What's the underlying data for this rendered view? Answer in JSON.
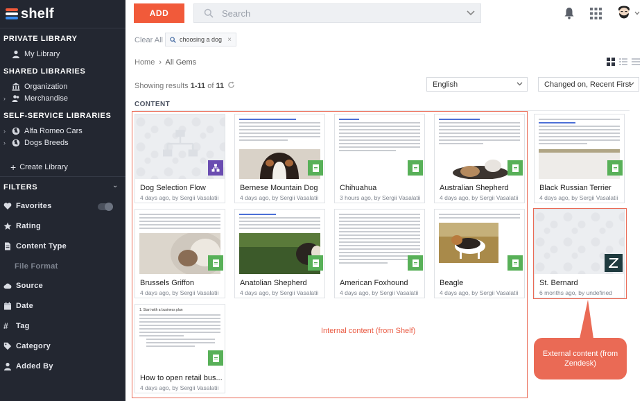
{
  "brand": {
    "name": "shelf"
  },
  "sidebar": {
    "private_library": "PRIVATE LIBRARY",
    "my_library": "My Library",
    "shared_libraries": "SHARED LIBRARIES",
    "organization": "Organization",
    "merchandise": "Merchandise",
    "self_service": "SELF-SERVICE LIBRARIES",
    "alfa_romeo": "Alfa Romeo Cars",
    "dogs_breeds": "Dogs Breeds",
    "create_library": "Create Library",
    "filters": "FILTERS",
    "filter_items": [
      "Favorites",
      "Rating",
      "Content Type",
      "File Format",
      "Source",
      "Date",
      "Tag",
      "Category",
      "Added By"
    ]
  },
  "toolbar": {
    "add_label": "ADD",
    "search_placeholder": "Search"
  },
  "filters_bar": {
    "clear_all": "Clear All",
    "chip_label": "choosing a dog"
  },
  "breadcrumb": {
    "home": "Home",
    "sep": "›",
    "current": "All Gems"
  },
  "results": {
    "prefix": "Showing results",
    "range": "1-11",
    "of": "of",
    "total": "11"
  },
  "language_select": "English",
  "sort_select": "Changed on, Recent First",
  "section_title": "CONTENT",
  "cards": [
    {
      "title": "Dog Selection Flow",
      "meta": "4 days ago, by Sergii Vasalatii"
    },
    {
      "title": "Bernese Mountain Dog",
      "meta": "4 days ago, by Sergii Vasalatii"
    },
    {
      "title": "Chihuahua",
      "meta": "3 hours ago, by Sergii Vasalatii"
    },
    {
      "title": "Australian Shepherd",
      "meta": "4 days ago, by Sergii Vasalatii"
    },
    {
      "title": "Black Russian Terrier",
      "meta": "4 days ago, by Sergii Vasalatii"
    },
    {
      "title": "Brussels Griffon",
      "meta": "4 days ago, by Sergii Vasalatii"
    },
    {
      "title": "Anatolian Shepherd",
      "meta": "4 days ago, by Sergii Vasalatii"
    },
    {
      "title": "American Foxhound",
      "meta": "4 days ago, by Sergii Vasalatii"
    },
    {
      "title": "Beagle",
      "meta": "4 days ago, by Sergii Vasalatii"
    },
    {
      "title": "St. Bernard",
      "meta": "6 months ago, by undefined"
    },
    {
      "title": "How to open retail bus...",
      "meta": "4 days ago, by Sergii Vasalatii"
    }
  ],
  "card_snippets": {
    "bernese": "With a distinctive tri-colored coat, the Bernese Mountain Dog is one of the most popular giant breeds.",
    "plan_heading": "1. Start with a business plan"
  },
  "annotations": {
    "internal": "Internal content (from Shelf)",
    "external": "External content (from Zendesk)"
  },
  "colors": {
    "accent": "#f15a3a",
    "sidebar_bg": "#232731",
    "doc_badge": "#58b058",
    "flow_badge": "#6a4cb1",
    "annotation": "#ea6a55"
  }
}
